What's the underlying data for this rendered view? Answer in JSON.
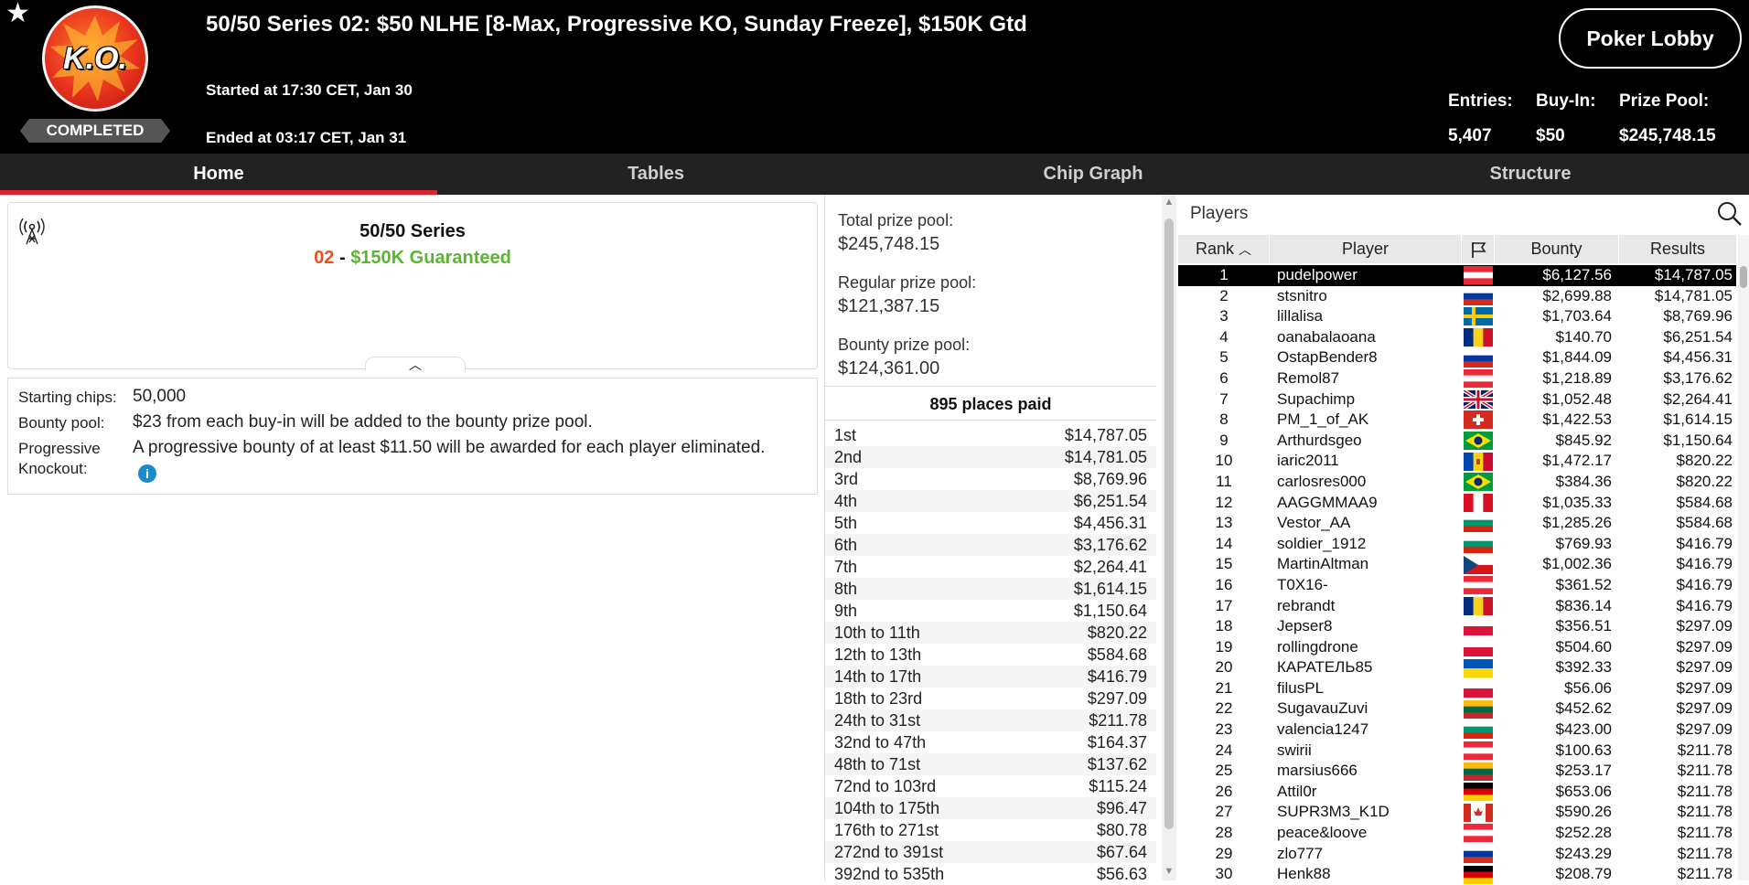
{
  "header": {
    "logo_text": "K.O.",
    "status": "COMPLETED",
    "title": "50/50 Series 02: $50 NLHE [8-Max, Progressive KO, Sunday Freeze], $150K Gtd",
    "started": "Started at 17:30 CET, Jan 30",
    "ended": "Ended at 03:17 CET, Jan 31",
    "lobby_button": "Poker Lobby",
    "entries_label": "Entries:",
    "entries_value": "5,407",
    "buyin_label": "Buy-In:",
    "buyin_value": "$50",
    "prize_label": "Prize Pool:",
    "prize_value": "$245,748.15"
  },
  "tabs": [
    {
      "label": "Home",
      "active": true
    },
    {
      "label": "Tables",
      "active": false
    },
    {
      "label": "Chip Graph",
      "active": false
    },
    {
      "label": "Structure",
      "active": false
    }
  ],
  "series": {
    "name": "50/50 Series",
    "number": "02",
    "dash": " - ",
    "guarantee": "$150K Guaranteed"
  },
  "info": {
    "chips_label": "Starting chips:",
    "chips_value": "50,000",
    "bounty_label": "Bounty pool:",
    "bounty_value": "$23 from each buy-in will be added to the bounty prize pool.",
    "pko_label_1": "Progressive",
    "pko_label_2": "Knockout:",
    "pko_value": "A progressive bounty of at least $11.50 will be awarded for each player eliminated.",
    "info_icon": "i"
  },
  "prize_pools": {
    "total_label": "Total prize pool:",
    "total_value": "$245,748.15",
    "regular_label": "Regular prize pool:",
    "regular_value": "$121,387.15",
    "bounty_label": "Bounty prize pool:",
    "bounty_value": "$124,361.00",
    "places_paid": "895 places paid"
  },
  "payouts": [
    [
      "1st",
      "$14,787.05"
    ],
    [
      "2nd",
      "$14,781.05"
    ],
    [
      "3rd",
      "$8,769.96"
    ],
    [
      "4th",
      "$6,251.54"
    ],
    [
      "5th",
      "$4,456.31"
    ],
    [
      "6th",
      "$3,176.62"
    ],
    [
      "7th",
      "$2,264.41"
    ],
    [
      "8th",
      "$1,614.15"
    ],
    [
      "9th",
      "$1,150.64"
    ],
    [
      "10th to 11th",
      "$820.22"
    ],
    [
      "12th to 13th",
      "$584.68"
    ],
    [
      "14th to 17th",
      "$416.79"
    ],
    [
      "18th to 23rd",
      "$297.09"
    ],
    [
      "24th to 31st",
      "$211.78"
    ],
    [
      "32nd to 47th",
      "$164.37"
    ],
    [
      "48th to 71st",
      "$137.62"
    ],
    [
      "72nd to 103rd",
      "$115.24"
    ],
    [
      "104th to 175th",
      "$96.47"
    ],
    [
      "176th to 271st",
      "$80.78"
    ],
    [
      "272nd to 391st",
      "$67.64"
    ],
    [
      "392nd to 535th",
      "$56.63"
    ]
  ],
  "players": {
    "title": "Players",
    "columns": {
      "rank": "Rank",
      "player": "Player",
      "bounty": "Bounty",
      "results": "Results"
    },
    "rows": [
      {
        "rank": "1",
        "name": "pudelpower",
        "flag": "austria",
        "bounty": "$6,127.56",
        "result": "$14,787.05"
      },
      {
        "rank": "2",
        "name": "stsnitro",
        "flag": "russia",
        "bounty": "$2,699.88",
        "result": "$14,781.05"
      },
      {
        "rank": "3",
        "name": "lillalisa",
        "flag": "sweden",
        "bounty": "$1,703.64",
        "result": "$8,769.96"
      },
      {
        "rank": "4",
        "name": "oanabalaoana",
        "flag": "romania",
        "bounty": "$140.70",
        "result": "$6,251.54"
      },
      {
        "rank": "5",
        "name": "OstapBender8",
        "flag": "russia",
        "bounty": "$1,844.09",
        "result": "$4,456.31"
      },
      {
        "rank": "6",
        "name": "Remol87",
        "flag": "austria",
        "bounty": "$1,218.89",
        "result": "$3,176.62"
      },
      {
        "rank": "7",
        "name": "Supachimp",
        "flag": "uk",
        "bounty": "$1,052.48",
        "result": "$2,264.41"
      },
      {
        "rank": "8",
        "name": "PM_1_of_AK",
        "flag": "switzerland",
        "bounty": "$1,422.53",
        "result": "$1,614.15"
      },
      {
        "rank": "9",
        "name": "Arthurdsgeo",
        "flag": "brazil",
        "bounty": "$845.92",
        "result": "$1,150.64"
      },
      {
        "rank": "10",
        "name": "iaric2011",
        "flag": "moldova",
        "bounty": "$1,472.17",
        "result": "$820.22"
      },
      {
        "rank": "11",
        "name": "carlosres000",
        "flag": "brazil",
        "bounty": "$384.36",
        "result": "$820.22"
      },
      {
        "rank": "12",
        "name": "AAGGMMAA9",
        "flag": "peru",
        "bounty": "$1,035.33",
        "result": "$584.68"
      },
      {
        "rank": "13",
        "name": "Vestor_AA",
        "flag": "bulgaria",
        "bounty": "$1,285.26",
        "result": "$584.68"
      },
      {
        "rank": "14",
        "name": "soldier_1912",
        "flag": "bulgaria",
        "bounty": "$769.93",
        "result": "$416.79"
      },
      {
        "rank": "15",
        "name": "MartinAltman",
        "flag": "czech",
        "bounty": "$1,002.36",
        "result": "$416.79"
      },
      {
        "rank": "16",
        "name": "T0X16-",
        "flag": "austria",
        "bounty": "$361.52",
        "result": "$416.79"
      },
      {
        "rank": "17",
        "name": "rebrandt",
        "flag": "romania",
        "bounty": "$836.14",
        "result": "$416.79"
      },
      {
        "rank": "18",
        "name": "Jepser8",
        "flag": "poland",
        "bounty": "$356.51",
        "result": "$297.09"
      },
      {
        "rank": "19",
        "name": "rollingdrone",
        "flag": "poland",
        "bounty": "$504.60",
        "result": "$297.09"
      },
      {
        "rank": "20",
        "name": "КАРАТЕЛЬ85",
        "flag": "ukraine",
        "bounty": "$392.33",
        "result": "$297.09"
      },
      {
        "rank": "21",
        "name": "filusPL",
        "flag": "poland",
        "bounty": "$56.06",
        "result": "$297.09"
      },
      {
        "rank": "22",
        "name": "SugavauZuvi",
        "flag": "lithuania",
        "bounty": "$452.62",
        "result": "$297.09"
      },
      {
        "rank": "23",
        "name": "valencia1247",
        "flag": "bulgaria",
        "bounty": "$423.00",
        "result": "$297.09"
      },
      {
        "rank": "24",
        "name": "swirii",
        "flag": "austria",
        "bounty": "$100.63",
        "result": "$211.78"
      },
      {
        "rank": "25",
        "name": "marsius666",
        "flag": "lithuania",
        "bounty": "$253.17",
        "result": "$211.78"
      },
      {
        "rank": "26",
        "name": "Attil0r",
        "flag": "germany",
        "bounty": "$653.06",
        "result": "$211.78"
      },
      {
        "rank": "27",
        "name": "SUPR3M3_K1D",
        "flag": "canada",
        "bounty": "$590.26",
        "result": "$211.78"
      },
      {
        "rank": "28",
        "name": "peace&loove",
        "flag": "austria",
        "bounty": "$252.28",
        "result": "$211.78"
      },
      {
        "rank": "29",
        "name": "zlo777",
        "flag": "russia",
        "bounty": "$243.29",
        "result": "$211.78"
      },
      {
        "rank": "30",
        "name": "Henk88",
        "flag": "germany",
        "bounty": "$208.79",
        "result": "$211.78"
      }
    ]
  },
  "icons": {
    "star": "star-icon",
    "antenna": "broadcast-icon",
    "search": "search-icon",
    "flag": "flag-icon",
    "sort": "sort-up-icon"
  }
}
